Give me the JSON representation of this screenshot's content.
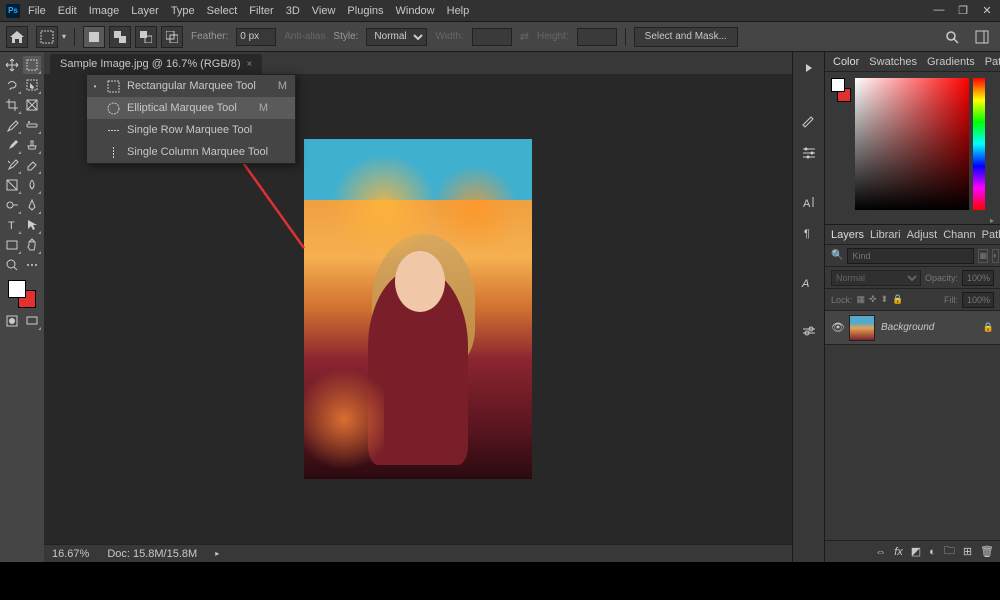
{
  "app": {
    "logo": "Ps"
  },
  "menu": [
    "File",
    "Edit",
    "Image",
    "Layer",
    "Type",
    "Select",
    "Filter",
    "3D",
    "View",
    "Plugins",
    "Window",
    "Help"
  ],
  "window_controls": {
    "min": "—",
    "max": "❐",
    "close": "✕"
  },
  "options": {
    "feather_label": "Feather:",
    "feather_value": "0 px",
    "antialias": "Anti-alias",
    "style_label": "Style:",
    "style_value": "Normal",
    "width_label": "Width:",
    "height_label": "Height:",
    "mask_btn": "Select and Mask..."
  },
  "document": {
    "tab_title": "Sample Image.jpg @ 16.7% (RGB/8)"
  },
  "flyout": {
    "items": [
      {
        "label": "Rectangular Marquee Tool",
        "shortcut": "M",
        "selected": true,
        "icon": "rect"
      },
      {
        "label": "Elliptical Marquee Tool",
        "shortcut": "M",
        "selected": false,
        "icon": "ellipse",
        "hover": true
      },
      {
        "label": "Single Row Marquee Tool",
        "shortcut": "",
        "selected": false,
        "icon": "row"
      },
      {
        "label": "Single Column Marquee Tool",
        "shortcut": "",
        "selected": false,
        "icon": "col"
      }
    ]
  },
  "status": {
    "zoom": "16.67%",
    "doc": "Doc: 15.8M/15.8M"
  },
  "color_panel": {
    "tabs": [
      "Color",
      "Swatches",
      "Gradients",
      "Patterns"
    ]
  },
  "layers_panel": {
    "tabs": [
      "Layers",
      "Librari",
      "Adjust",
      "Chann",
      "Paths"
    ],
    "kind": "Kind",
    "blend": "Normal",
    "opacity_label": "Opacity:",
    "opacity": "100%",
    "lock_label": "Lock:",
    "fill_label": "Fill:",
    "fill": "100%",
    "layer_name": "Background"
  },
  "swatch_colors": {
    "fg": "#ffffff",
    "bg": "#e03030"
  }
}
